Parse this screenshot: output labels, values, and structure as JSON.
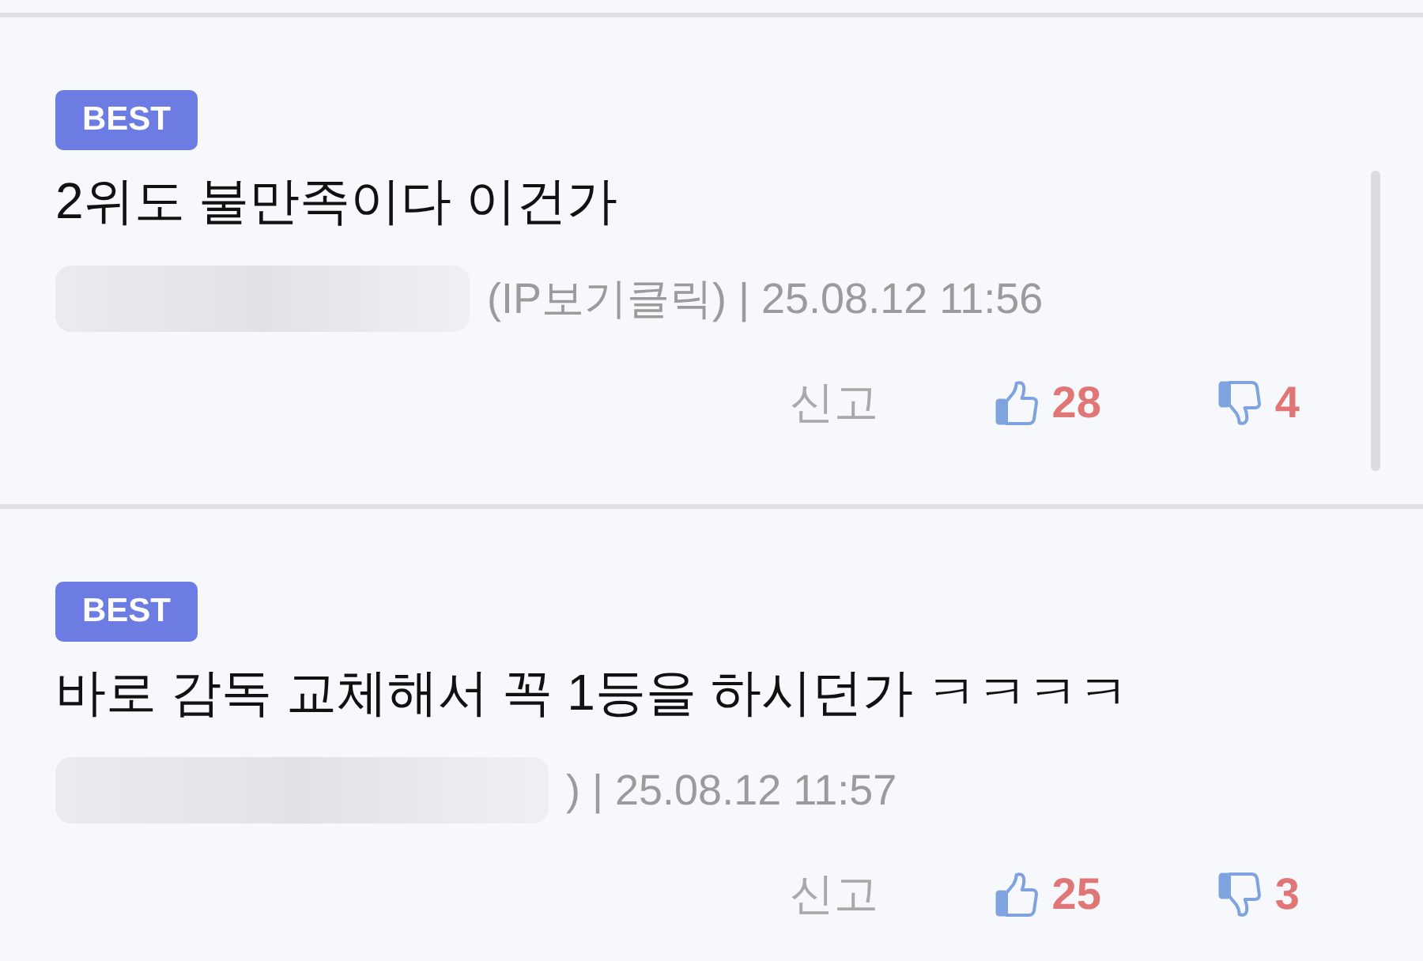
{
  "comments": [
    {
      "badge": "BEST",
      "text": "2위도 불만족이다 이건가",
      "meta": "(IP보기클릭) | 25.08.12 11:56",
      "report": "신고",
      "likes": "28",
      "dislikes": "4"
    },
    {
      "badge": "BEST",
      "text": "바로 감독 교체해서 꼭 1등을 하시던가 ㅋㅋㅋㅋ",
      "meta": ") | 25.08.12 11:57",
      "report": "신고",
      "likes": "25",
      "dislikes": "3"
    }
  ]
}
